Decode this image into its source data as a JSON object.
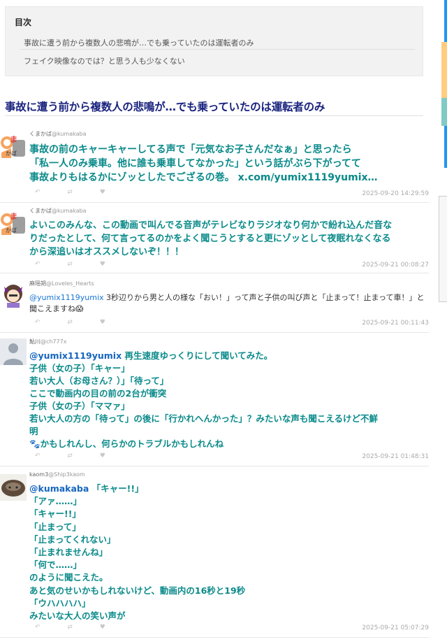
{
  "toc": {
    "title": "目次",
    "items": [
      "事故に遭う前から複数人の悲鳴が…でも乗っていたのは運転者のみ",
      "フェイク映像なのでは？と思う人も少なくない"
    ]
  },
  "heading": "事故に遭う前から複数人の悲鳴が…でも乗っていたのは運転者のみ",
  "actions": "↶ ⇄ ♥",
  "tweets": [
    {
      "name": "くまかば",
      "handle": "@kumakaba",
      "lines": [
        "事故の前のキャーキャーしてる声で「元気なお子さんだなぁ」と思ったら",
        "「私一人のみ乗車。他に誰も乗車してなかった」という話がぶら下がってて",
        "事故よりもはるかにゾッとしたでござるの巻。 x.com/yumix1119yumix…"
      ],
      "timestamp": "2025-09-20 14:29:59"
    },
    {
      "name": "くまかば",
      "handle": "@kumakaba",
      "lines": [
        "よいこのみんな、この動画で叫んでる音声がテレビなりラジオなり何かで紛れ込んだ音な",
        "りだったとして、何て言ってるのかをよく聞こうとすると更にゾッとして夜眠れなくなる",
        "から深追いはオススメしないぞ！！！"
      ],
      "timestamp": "2025-09-21 00:08:27"
    },
    {
      "name": "麻瑶朔",
      "handle": "@Loveles_Hearts",
      "mention": "@yumix1119yumix",
      "lines": [
        " 3秒辺りから男と人の様な「おい！」って声と子供の叫び声と「止まって！止まって車！」と",
        "聞こえますね😱"
      ],
      "timestamp": "2025-09-21 00:11:43"
    },
    {
      "name": "鮎川",
      "handle": "@ch777x",
      "mention": "@yumix1119yumix",
      "lines": [
        " 再生速度ゆっくりにして聞いてみた。",
        "子供（女の子）「キャー」",
        "若い大人（お母さん？）」「待って」",
        "ここで動画内の目の前の2台が衝突",
        "子供（女の子）「ママァ」",
        "若い大人の方の「待って」の後に「行かれへんかった」？みたいな声も聞こえるけど不鮮",
        "明",
        "🐾かもしれんし、何らかのトラブルかもしれんね"
      ],
      "timestamp": "2025-09-21 01:48:31"
    },
    {
      "name": "kaom3",
      "handle": "@Ship3kaom",
      "mention": "@kumakaba",
      "lines": [
        " 「キャー!!」",
        "「アァ……」",
        "「キャー!!」",
        "「止まって」",
        "「止まってくれない」",
        "「止まれませんね」",
        "「何で……」",
        "のように聞こえた。",
        "あと気のせいかもしれないけど、動画内の16秒と19秒",
        "「ウハハハハ」",
        "みたいな大人の笑い声が"
      ],
      "timestamp": "2025-09-21 05:07:29"
    }
  ],
  "colors": {
    "tweet_text": "#0b8a8a",
    "mention": "#1565c0",
    "heading": "#1a237e"
  }
}
